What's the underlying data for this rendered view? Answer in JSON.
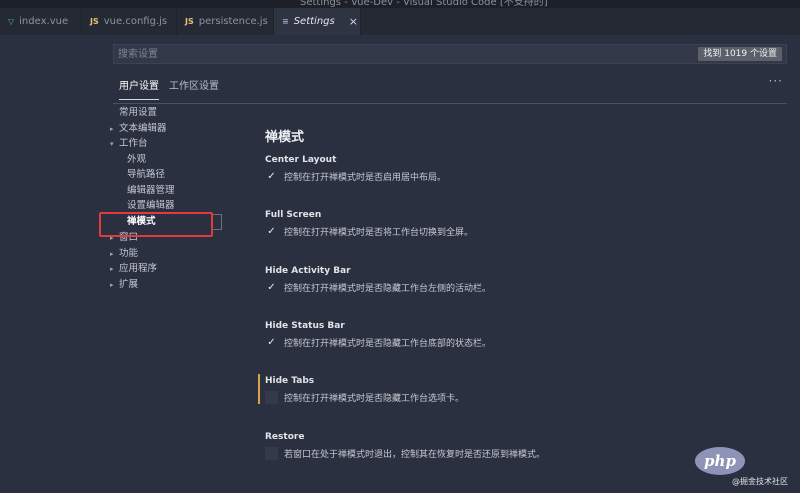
{
  "window": {
    "title_partial": "Settings - Vue-Dev - Visual Studio Code [不支持的]"
  },
  "tabs": [
    {
      "label": "index.vue",
      "icon": "vue-file-icon",
      "glyph": "▽"
    },
    {
      "label": "vue.config.js",
      "icon": "js-file-icon",
      "glyph": "JS"
    },
    {
      "label": "persistence.js",
      "icon": "js-file-icon",
      "glyph": "JS"
    },
    {
      "label": "Settings",
      "icon": "settings-file-icon",
      "glyph": "≡",
      "active": true,
      "close": "×"
    }
  ],
  "search": {
    "placeholder": "搜索设置",
    "count": "找到 1019 个设置"
  },
  "scopes": {
    "user": "用户设置",
    "workspace": "工作区设置",
    "more": "···"
  },
  "toc": [
    {
      "label": "常用设置",
      "chevron": ""
    },
    {
      "label": "文本编辑器",
      "chevron": "▸"
    },
    {
      "label": "工作台",
      "chevron": "▾"
    },
    {
      "label": "外观",
      "chevron": ""
    },
    {
      "label": "导航路径",
      "chevron": ""
    },
    {
      "label": "编辑器管理",
      "chevron": ""
    },
    {
      "label": "设置编辑器",
      "chevron": ""
    },
    {
      "label": "禅模式",
      "chevron": "",
      "selected": true
    },
    {
      "label": "窗口",
      "chevron": "▸"
    },
    {
      "label": "功能",
      "chevron": "▸"
    },
    {
      "label": "应用程序",
      "chevron": "▸"
    },
    {
      "label": "扩展",
      "chevron": "▸"
    }
  ],
  "section_title": "禅模式",
  "settings": [
    {
      "title": "Center Layout",
      "description": "控制在打开禅模式时是否启用居中布局。",
      "checked": true,
      "mark": "✓"
    },
    {
      "title": "Full Screen",
      "description": "控制在打开禅模式时是否将工作台切换到全屏。",
      "checked": true,
      "mark": "✓"
    },
    {
      "title": "Hide Activity Bar",
      "description": "控制在打开禅模式时是否隐藏工作台左侧的活动栏。",
      "checked": true,
      "mark": "✓"
    },
    {
      "title": "Hide Status Bar",
      "description": "控制在打开禅模式时是否隐藏工作台底部的状态栏。",
      "checked": true,
      "mark": "✓"
    },
    {
      "title": "Hide Tabs",
      "description": "控制在打开禅模式时是否隐藏工作台选项卡。",
      "checked": false,
      "mark": ""
    },
    {
      "title": "Restore",
      "description": "若窗口在处于禅模式时退出，控制其在恢复时是否还原到禅模式。",
      "checked": false,
      "mark": ""
    }
  ],
  "watermark": {
    "logo": "php",
    "text": "@掘金技术社区"
  },
  "colors": {
    "background": "#2b3040",
    "highlight_border": "#e23b3b",
    "focus_bar": "#d8a24a"
  }
}
